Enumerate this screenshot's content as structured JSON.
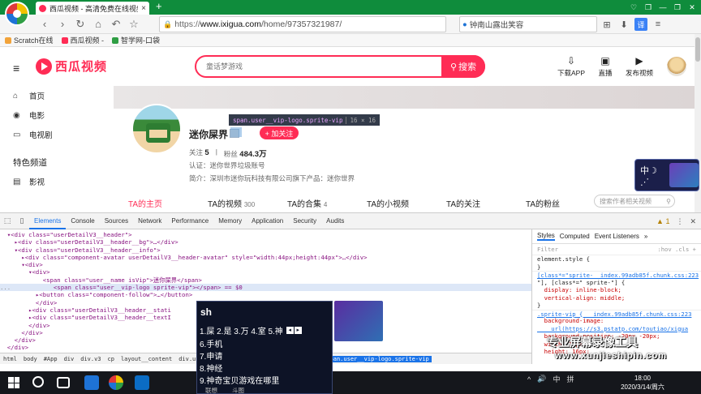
{
  "browser": {
    "tab_title": "西瓜视频 - 高清免费在线视频",
    "tab_close": "×",
    "new_tab": "+",
    "window_buttons": [
      "♡",
      "❒",
      "—",
      "❐",
      "✕"
    ],
    "nav_buttons": [
      "‹",
      "›",
      "↻",
      "⌂",
      "↶",
      "☆"
    ],
    "address_https": "https://",
    "address_host": "www.ixigua.com",
    "address_path": "/home/97357321987/",
    "search_text": "钟南山露出笑容",
    "right_icons": [
      "⊞",
      "⬇",
      "译",
      "≡"
    ]
  },
  "bookmarks": [
    {
      "label": "Scratch在线",
      "color": "#f2a33a"
    },
    {
      "label": "西瓜视频 -",
      "color": "#ff2c55"
    },
    {
      "label": "智学网-口袋",
      "color": "#2f9e44"
    }
  ],
  "site": {
    "logo_text": "西瓜视频",
    "search_placeholder": "童话梦游戏",
    "search_button": "搜索",
    "actions": [
      {
        "icon": "⇩",
        "label": "下载APP"
      },
      {
        "icon": "▣",
        "label": "直播"
      },
      {
        "icon": "▶",
        "label": "发布视频"
      }
    ],
    "hamburger": "≡"
  },
  "sidebar": {
    "items": [
      {
        "icon": "⌂",
        "label": "首页"
      },
      {
        "icon": "◉",
        "label": "电影"
      },
      {
        "icon": "▭",
        "label": "电视剧"
      }
    ],
    "section_title": "特色频道",
    "section_items": [
      {
        "icon": "▤",
        "label": "影视"
      }
    ]
  },
  "profile": {
    "name": "迷你屎界",
    "follow_button": "+ 加关注",
    "following_label": "关注",
    "following_count": "5",
    "fans_label": "粉丝",
    "fans_count": "484.3万",
    "certification": "认证：迷你世界垃圾账号",
    "intro": "简介：深圳市迷你玩科技有限公司旗下产品：迷你世界",
    "tabs": [
      {
        "label": "TA的主页",
        "count": ""
      },
      {
        "label": "TA的视频",
        "count": "300"
      },
      {
        "label": "TA的合集",
        "count": "4"
      },
      {
        "label": "TA的小视频",
        "count": ""
      },
      {
        "label": "TA的关注",
        "count": ""
      },
      {
        "label": "TA的粉丝",
        "count": ""
      }
    ],
    "search_works_placeholder": "搜索作者相关视频"
  },
  "tooltip": {
    "selector": "span.user__vip-logo.sprite-vip",
    "size": "16 × 16"
  },
  "ad": {
    "text": "中☽ ⋰"
  },
  "devtools": {
    "left_icons": [
      "⬚",
      "▯"
    ],
    "tabs": [
      "Elements",
      "Console",
      "Sources",
      "Network",
      "Performance",
      "Memory",
      "Application",
      "Security",
      "Audits"
    ],
    "active_tab": "Elements",
    "warnings": "▲ 1",
    "menu": "⋮",
    "close": "✕",
    "element_lines": [
      "  ▾<div class=\"userDetailV3__header\">",
      "    ▸<div class=\"userDetailV3__header__bg\">…</div>",
      "    ▾<div class=\"userDetailV3__header__info\">",
      "      ▸<div class=\"component-avatar userDetailV3__header-avatar\" style=\"width:44px;height:44px\">…</div>",
      "      ▾<div>",
      "        ▾<div>",
      "            <span class=\"user__name isVip\">迷你屎界</span>",
      "            <span class=\"user__vip-logo sprite-vip\"></span> == $0",
      "          ▸<button class=\"component-follow\">…</button>",
      "          </div>",
      "        ▸<div class=\"userDetailV3__header__stati",
      "        ▸<div class=\"userDetailV3__header__textI",
      "        </div>",
      "      </div>",
      "    </div>",
      "  </div>"
    ],
    "selected_line_index": 7,
    "selected_marker": "...",
    "breadcrumbs": [
      "html",
      "body",
      "#App",
      "div",
      "div.v3",
      "cp",
      "layout__content",
      "div.userDetail",
      "…",
      "header__info",
      "div",
      "div",
      "span.user__vip-logo.sprite-vip"
    ],
    "styles_tabs": [
      "Styles",
      "Computed",
      "Event Listeners",
      "»"
    ],
    "styles_filter": "Filter",
    "styles_filter_right": ":hov  .cls  +",
    "style_lines": [
      {
        "text": "element.style {",
        "type": "plain"
      },
      {
        "text": "}",
        "type": "plain"
      },
      {
        "text": "[class*=\"sprite-  index.99adb85f.chunk.css:223",
        "type": "link"
      },
      {
        "text": "\"], [class*=\" sprite-\"] {",
        "type": "plain"
      },
      {
        "text": "  display: inline-block;",
        "type": "prop"
      },
      {
        "text": "  vertical-align: middle;",
        "type": "prop"
      },
      {
        "text": "}",
        "type": "plain"
      },
      {
        "text": ".sprite-vip {   index.99adb85f.chunk.css:223",
        "type": "link"
      },
      {
        "text": "  background-image:",
        "type": "prop"
      },
      {
        "text": "    url(https://s3.pstatp.com/toutiao/xigua",
        "type": "link"
      },
      {
        "text": "  background-position: -20px -20px;",
        "type": "prop"
      },
      {
        "text": "  width: 16px;",
        "type": "prop"
      },
      {
        "text": "  height: 16px;",
        "type": "prop"
      }
    ]
  },
  "ime": {
    "input": "sh",
    "first_row": "1.屎  2.是  3.万  4.室  5.神",
    "arrows": [
      "◂",
      "▸"
    ],
    "candidates": [
      "6.手机",
      "7.申请",
      "8.神经",
      "9.神奇宝贝游戏在哪里"
    ],
    "footer": [
      "联想",
      "斗图"
    ]
  },
  "watermark": {
    "line1": "专业屏幕录像工具",
    "line2": "www.xunjieshipin.com"
  },
  "taskbar": {
    "tray": [
      "^",
      "🔊",
      "中",
      "拼"
    ],
    "time": "18:00",
    "date": "2020/3/14/周六"
  },
  "colors": {
    "brand": "#ff2c55",
    "browser_green": "#0f8c3c",
    "devtools_blue": "#1a73e8"
  }
}
